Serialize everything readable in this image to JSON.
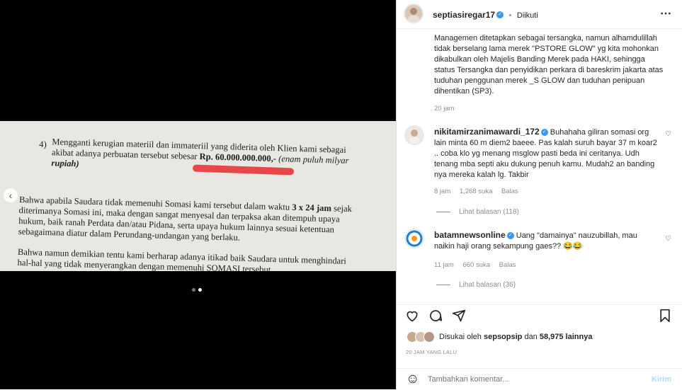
{
  "media": {
    "document": {
      "num": "4)",
      "p1_l1": "Mengganti kerugian materiil dan immateriil yang diderita oleh Klien kami sebagai",
      "p1_l2a": "akibat adanya perbuatan tersebut sebesar ",
      "p1_amount": "Rp. 60.000.000.000,-",
      "p1_l2b": " (enam puluh milyar",
      "p1_l3": "rupiah)",
      "p2_l1a": "Bahwa apabila Saudara tidak memenuhi Somasi kami tersebut dalam waktu ",
      "p2_bold": "3 x 24 jam",
      "p2_l1b": " sejak",
      "p2_l2": "diterimanya Somasi ini, maka dengan sangat menyesal dan terpaksa akan ditempuh upaya",
      "p2_l3": "hukum, baik ranah Perdata dan/atau Pidana, serta upaya hukum lainnya sesuai ketentuan",
      "p2_l4": "sebagaimana diatur dalam Perundang-undangan yang berlaku.",
      "p3_l1": "Bahwa namun demikian tentu kami berharap adanya itikad baik Saudara untuk menghindari",
      "p3_l2": "hal-hal  yang tidak menyerangkan dengan memenuhi SOMASI tersebut."
    },
    "prev_icon": "chevron-left-icon",
    "prev_glyph": "‹"
  },
  "header": {
    "username": "septiasiregar17",
    "verified_glyph": "✓",
    "separator": "•",
    "follow_status": "Diikuti",
    "more_glyph": "⋯"
  },
  "caption": {
    "text": "Managemen ditetapkan sebagai tersangka, namun alhamdulillah tidak berselang lama merek \"PSTORE GLOW\" yg kita mohonkan dikabulkan oleh Majelis Banding Merek pada HAKI, sehingga status Tersangka dan penyidikan perkara di bareskrim jakarta atas tuduhan penggunan merek _S GLOW dan tuduhan penipuan dihentikan (SP3).",
    "time": "20 jam"
  },
  "comments": [
    {
      "username": "nikitamirzanimawardi_172",
      "text": "Buhahaha giliran somasi org lain minta 60 m diem2 baeee. Pas kalah suruh bayar 37 m koar2 .. coba klo yg menang msglow pasti beda ini ceritanya. Udh tenang mba septi aku dukung penuh kamu. Mudah2 an banding nya mereka kalah lg. Takbir",
      "time": "8 jam",
      "likes": "1,268 suka",
      "reply": "Balas",
      "view_replies": "Lihat balasan (118)"
    },
    {
      "username": "batamnewsonline",
      "text": "Uang \"damainya\" nauzubillah, mau naikin haji orang sekampung gaes?? 😂😂",
      "time": "11 jam",
      "likes": "660 suka",
      "reply": "Balas",
      "view_replies": "Lihat balasan (36)"
    }
  ],
  "likes_line": {
    "prefix": "Disukai oleh ",
    "user": "sepsopsip",
    "middle": " dan ",
    "count": "58,975 lainnya"
  },
  "post_time": "20 JAM YANG LALU",
  "composer": {
    "emoji_glyph": "☺",
    "placeholder": "Tambahkan komentar...",
    "submit": "Kirim"
  },
  "icons": {
    "like": "heart-icon",
    "comment": "comment-icon",
    "share": "share-icon",
    "save": "bookmark-icon"
  },
  "colors": {
    "verified": "#3897f0",
    "submit_disabled": "#b3dbff",
    "highlight": "#e8474a"
  }
}
